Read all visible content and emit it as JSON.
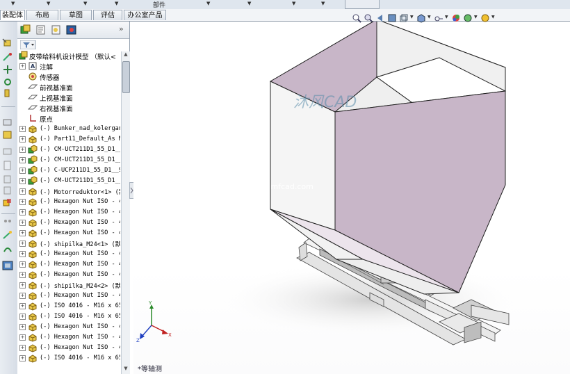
{
  "topbar": {
    "parts_label": "部件"
  },
  "command_tabs": [
    {
      "label": "装配体",
      "active": true
    },
    {
      "label": "布局"
    },
    {
      "label": "草图"
    },
    {
      "label": "评估"
    },
    {
      "label": "办公室产品"
    }
  ],
  "feature_tree": {
    "root_label": "皮带给料机设计模型 （默认<",
    "items": [
      {
        "label": "注解",
        "icon": "annotation-icon",
        "expandable": true
      },
      {
        "label": "传感器",
        "icon": "sensor-icon",
        "expandable": false
      },
      {
        "label": "前视基准面",
        "icon": "plane-icon",
        "expandable": false
      },
      {
        "label": "上视基准面",
        "icon": "plane-icon",
        "expandable": false
      },
      {
        "label": "右视基准面",
        "icon": "plane-icon",
        "expandable": false
      },
      {
        "label": "原点",
        "icon": "origin-icon",
        "expandable": false
      },
      {
        "label": "(-) Bunker_nad_kolergan",
        "icon": "part-icon"
      },
      {
        "label": "(-) Part11_Default_As M",
        "icon": "part-icon"
      },
      {
        "label": "(-) CM-UCT211D1_55_D1__",
        "icon": "subassembly-icon"
      },
      {
        "label": "(-) CM-UCT211D1_55_D1__",
        "icon": "subassembly-icon"
      },
      {
        "label": "(-) C-UCP211D1_55_D1__9",
        "icon": "subassembly-icon"
      },
      {
        "label": "(-) CM-UCT211D1_55_D1__",
        "icon": "subassembly-icon"
      },
      {
        "label": "(-) Motorreduktor<1> (默",
        "icon": "part-icon"
      },
      {
        "label": "(-) Hexagon Nut ISO - 4",
        "icon": "part-icon"
      },
      {
        "label": "(-) Hexagon Nut ISO - 4",
        "icon": "part-icon"
      },
      {
        "label": "(-) Hexagon Nut ISO - 4",
        "icon": "part-icon"
      },
      {
        "label": "(-) Hexagon Nut ISO - 4",
        "icon": "part-icon"
      },
      {
        "label": "(-) shipilka_M24<1> (默",
        "icon": "part-icon"
      },
      {
        "label": "(-) Hexagon Nut ISO - 4",
        "icon": "part-icon"
      },
      {
        "label": "(-) Hexagon Nut ISO - 4",
        "icon": "part-icon"
      },
      {
        "label": "(-) Hexagon Nut ISO - 4",
        "icon": "part-icon"
      },
      {
        "label": "(-) shipilka_M24<2> (默",
        "icon": "part-icon"
      },
      {
        "label": "(-) Hexagon Nut ISO - 4",
        "icon": "part-icon"
      },
      {
        "label": "(-) ISO 4016 - M16 x 65",
        "icon": "part-icon"
      },
      {
        "label": "(-) ISO 4016 - M16 x 65",
        "icon": "part-icon"
      },
      {
        "label": "(-) Hexagon Nut ISO - 4",
        "icon": "part-icon"
      },
      {
        "label": "(-) Hexagon Nut ISO - 4",
        "icon": "part-icon"
      },
      {
        "label": "(-) Hexagon Nut ISO - 4",
        "icon": "part-icon"
      },
      {
        "label": "(-) ISO 4016 - M16 x 65",
        "icon": "part-icon"
      }
    ]
  },
  "viewport": {
    "view_name": "*等轴测",
    "watermark": "沐风CAD",
    "watermark_url": "www.mfcad.com"
  },
  "colors": {
    "hopper_face": "#c8b6c8",
    "hopper_light": "#f6f6f6",
    "panel_bg": "#ffffff",
    "chrome": "#dfe6ee"
  }
}
